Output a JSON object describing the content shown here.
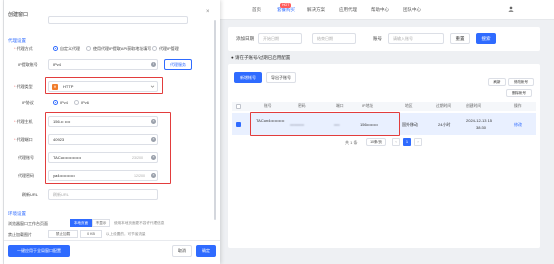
{
  "window_title": "创建窗口",
  "nav": {
    "items": [
      "首页",
      "套餐购买",
      "解决方案",
      "应用代理",
      "帮助中心",
      "团队中心"
    ],
    "active_index": 1,
    "hot_badge": "HOT",
    "user_icon": "user-icon"
  },
  "filters": {
    "create_time_label": "添加日期",
    "start_placeholder": "开始日期",
    "end_placeholder": "结束日期",
    "account_label": "账号",
    "account_placeholder": "请输入账号",
    "reset_label": "重置",
    "search_label": "搜索"
  },
  "note": "● 请在子账号/过期已启用配置",
  "list": {
    "buy_label": "新增帐号",
    "sub_label": "导出子账号",
    "tools": [
      "刷新",
      "修改帐号",
      "删除帐号"
    ],
    "columns": [
      "账号",
      "密码",
      "端口",
      "IP地址",
      "地区",
      "过期时间",
      "创建时间",
      "操作"
    ],
    "row": {
      "account": "TACun4••••••••••",
      "password": "••••••••••",
      "port": "••••",
      "ip": "156••••••••",
      "region": "国外移动",
      "expire": "24小时",
      "created_date": "2024-12-13 15",
      "created_time": "38:30",
      "action": "修改"
    },
    "pager": {
      "total_text": "共 1 条",
      "page_size": "10条/页",
      "current_page": "1"
    }
  },
  "modal": {
    "section_proxy": "代理设置",
    "proxy_mode_label": "代理方式",
    "proxy_mode_options": [
      "自定义代理",
      "使用代理IP提取API获取地址填写",
      "代理IP管理"
    ],
    "selected_proxy_mode": 0,
    "proxy_account_label": "IP提取账号",
    "proxy_account_value": "IPv4",
    "proxy_service_button": "代理服务",
    "proxy_type_label": "代理类型",
    "proxy_type_value": "HTTP",
    "ip_version_label": "IP协议",
    "ip_version_options": [
      "IPv4",
      "IPv6"
    ],
    "selected_ip_version": 0,
    "host_label": "代理主机",
    "host_value": "156.•• ••••",
    "port_label": "代理端口",
    "port_value": "40923",
    "user_label": "代理账号",
    "user_value": "TACu•••••••••••••",
    "user_count": "23/200",
    "pass_label": "代理密码",
    "pass_value": "ya4•••••••••••",
    "pass_count": "12/200",
    "refresh_label": "刷新URL",
    "refresh_placeholder": "刷新URL",
    "section_env": "环境设置",
    "env_label": "浏览器窗口工作台页面",
    "env_on": "本地页面",
    "env_off": "不显示",
    "env_hint": "使用本地页面更不容许代理信息",
    "block_label": "禁止加载图片",
    "block_value": "禁止加载",
    "block_unit": "0  KB",
    "block_hint": "以上设置的，可节省流量",
    "footer_left": "一键应用于全局窗口配置",
    "cancel_label": "取消",
    "ok_label": "确定"
  },
  "colors": {
    "accent": "#2f6bff",
    "highlight": "#e23d3d",
    "http_tag": "#f07c2c"
  }
}
